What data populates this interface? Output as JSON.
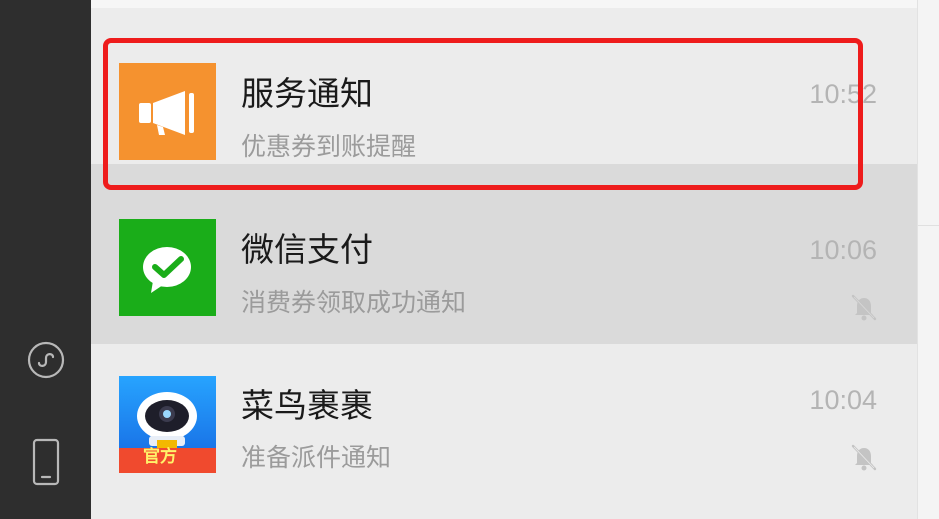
{
  "sidebar": {
    "icons": [
      "miniprogram-icon",
      "phone-icon"
    ]
  },
  "chats": [
    {
      "name": "服务通知",
      "preview": "优惠券到账提醒",
      "time": "10:52",
      "avatar": "megaphone-icon",
      "avatar_color": "#f5922f",
      "muted": false,
      "selected": false
    },
    {
      "name": "微信支付",
      "preview": "消费券领取成功通知",
      "time": "10:06",
      "avatar": "wechat-pay-icon",
      "avatar_color": "#1aad19",
      "muted": true,
      "selected": true
    },
    {
      "name": "菜鸟裹裹",
      "preview": "准备派件通知",
      "time": "10:04",
      "avatar": "cainiao-robot-icon",
      "avatar_badge": "官方",
      "avatar_color": "#1e8cff",
      "muted": true,
      "selected": false
    }
  ],
  "colors": {
    "highlight": "#ee1c1c",
    "sidebar": "#2e2e2e",
    "list_bg": "#ececec",
    "selected_bg": "#dadada"
  }
}
